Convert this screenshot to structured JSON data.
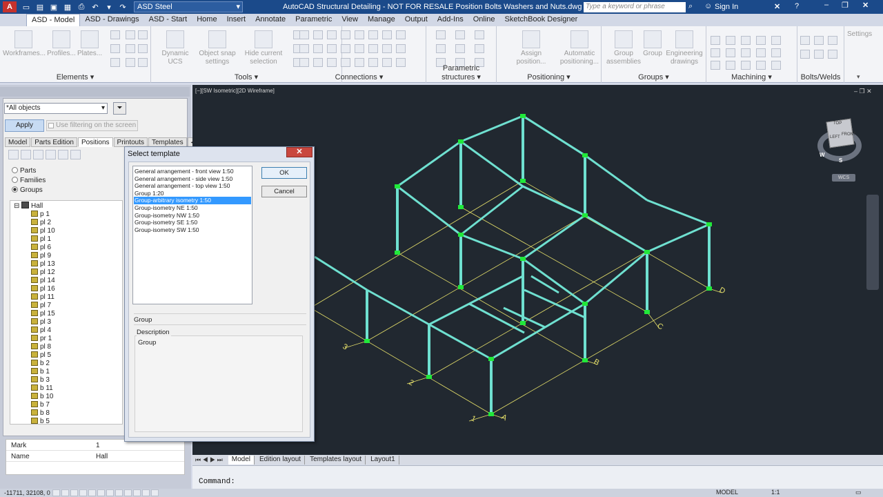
{
  "titlebar": {
    "workspace": "ASD Steel",
    "app_title": "AutoCAD Structural Detailing  -  NOT FOR RESALE    Position Bolts Washers and Nuts.dwg",
    "search_placeholder": "Type a keyword or phrase",
    "sign_in": "Sign In"
  },
  "ribbon_tabs": [
    "ASD - Model",
    "ASD - Drawings",
    "ASD - Start",
    "Home",
    "Insert",
    "Annotate",
    "Parametric",
    "View",
    "Manage",
    "Output",
    "Add-Ins",
    "Online",
    "SketchBook Designer"
  ],
  "ribbon": {
    "elements": {
      "title": "Elements",
      "workframes": "Workframes...",
      "profiles": "Profiles...",
      "plates": "Plates..."
    },
    "tools": {
      "title": "Tools",
      "dynamic_ucs": "Dynamic UCS",
      "snap": "Object snap settings",
      "hide": "Hide current selection"
    },
    "connections": {
      "title": "Connections"
    },
    "parametric": {
      "title": "Parametric structures"
    },
    "positioning": {
      "title": "Positioning",
      "assign": "Assign position...",
      "auto": "Automatic positioning..."
    },
    "groups": {
      "title": "Groups",
      "group_assemblies": "Group assemblies",
      "group": "Group",
      "engineering": "Engineering drawings"
    },
    "machining": {
      "title": "Machining"
    },
    "bolts": {
      "title": "Bolts/Welds"
    },
    "settings": "Settings"
  },
  "palette": {
    "filter_value": "*All objects",
    "apply": "Apply",
    "use_filtering": "Use filtering on the screen",
    "tabs": [
      "Model",
      "Parts Edition",
      "Positions",
      "Printouts",
      "Templates"
    ],
    "radios": [
      "Parts",
      "Families",
      "Groups"
    ],
    "tree_root": "Hall",
    "tree_items": [
      "p 1",
      "pl 2",
      "pl 10",
      "pl 1",
      "pl 6",
      "pl 9",
      "pl 13",
      "pl 12",
      "pl 14",
      "pl 16",
      "pl 11",
      "pl 7",
      "pl 15",
      "pl 3",
      "pl 4",
      "pr 1",
      "pl 8",
      "pl 5",
      "b 2",
      "b 1",
      "b 3",
      "b 11",
      "b 10",
      "b 7",
      "b 8",
      "b 5"
    ],
    "props": [
      {
        "key": "Mark",
        "value": "1"
      },
      {
        "key": "Name",
        "value": "Hall"
      }
    ]
  },
  "viewport": {
    "label": "[−][SW Isometric][2D Wireframe]",
    "axes": [
      "1",
      "2",
      "3",
      "A",
      "B",
      "C",
      "D"
    ],
    "viewcube_faces": [
      "TOP",
      "LEFT",
      "FRONT"
    ],
    "compass": [
      "W",
      "S"
    ],
    "wcs": "WCS"
  },
  "layout_tabs": [
    "Model",
    "Edition layout",
    "Templates layout",
    "Layout1"
  ],
  "command": "Command:",
  "status": {
    "coords": "-11711, 32108, 0",
    "model": "MODEL",
    "scale": "1:1"
  },
  "dialog": {
    "title": "Select template",
    "close": "✕",
    "templates": [
      "General arrangement - front view 1:50",
      "General arrangement - side view 1:50",
      "General arrangement - top view 1:50",
      "Group 1:20",
      "Group-arbitrary isometry 1:50",
      "Group-isometry NE 1:50",
      "Group-isometry NW 1:50",
      "Group-isometry SE 1:50",
      "Group-isometry SW 1:50"
    ],
    "selected_index": 4,
    "ok": "OK",
    "cancel": "Cancel",
    "group_label": "Group",
    "description_label": "Description",
    "description_value": "Group"
  },
  "colors": {
    "title_bar": "#1b4a8a",
    "viewport_bg": "#212830",
    "steel": "#6fe0d0",
    "grid": "#e6e06a",
    "selection": "#3399ff"
  }
}
